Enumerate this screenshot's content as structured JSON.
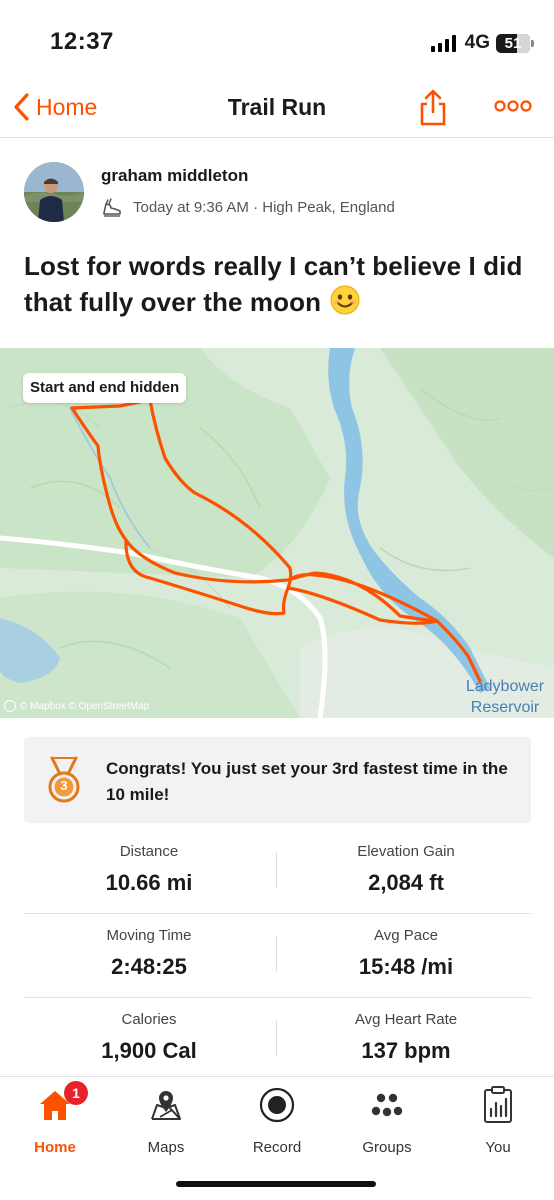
{
  "status_bar": {
    "time": "12:37",
    "network": "4G",
    "battery": "51"
  },
  "nav": {
    "back_label": "Home",
    "title": "Trail Run"
  },
  "athlete": {
    "name": "graham middleton",
    "meta": "Today at 9:36 AM · High Peak, England"
  },
  "activity": {
    "title": "Lost for words really I can’t believe I did that fully over the moon",
    "emoji": "😊"
  },
  "map": {
    "badge": "Start and end hidden",
    "attribution": "© Mapbox © OpenStreetMap",
    "reservoir_label_line1": "Ladybower",
    "reservoir_label_line2": "Reservoir",
    "route_color": "#fc5200"
  },
  "achievement": {
    "text": "Congrats! You just set your 3rd fastest time in the 10 mile!",
    "medal_rank": "3"
  },
  "stats": [
    {
      "left_label": "Distance",
      "left_value": "10.66 mi",
      "right_label": "Elevation Gain",
      "right_value": "2,084 ft"
    },
    {
      "left_label": "Moving Time",
      "left_value": "2:48:25",
      "right_label": "Avg Pace",
      "right_value": "15:48 /mi"
    },
    {
      "left_label": "Calories",
      "left_value": "1,900 Cal",
      "right_label": "Avg Heart Rate",
      "right_value": "137 bpm"
    }
  ],
  "tabs": [
    {
      "label": "Home",
      "icon": "home-icon",
      "badge": "1"
    },
    {
      "label": "Maps",
      "icon": "maps-icon"
    },
    {
      "label": "Record",
      "icon": "record-icon"
    },
    {
      "label": "Groups",
      "icon": "groups-icon"
    },
    {
      "label": "You",
      "icon": "profile-icon"
    }
  ],
  "colors": {
    "accent": "#fc5200",
    "badge_red": "#e8222a"
  }
}
